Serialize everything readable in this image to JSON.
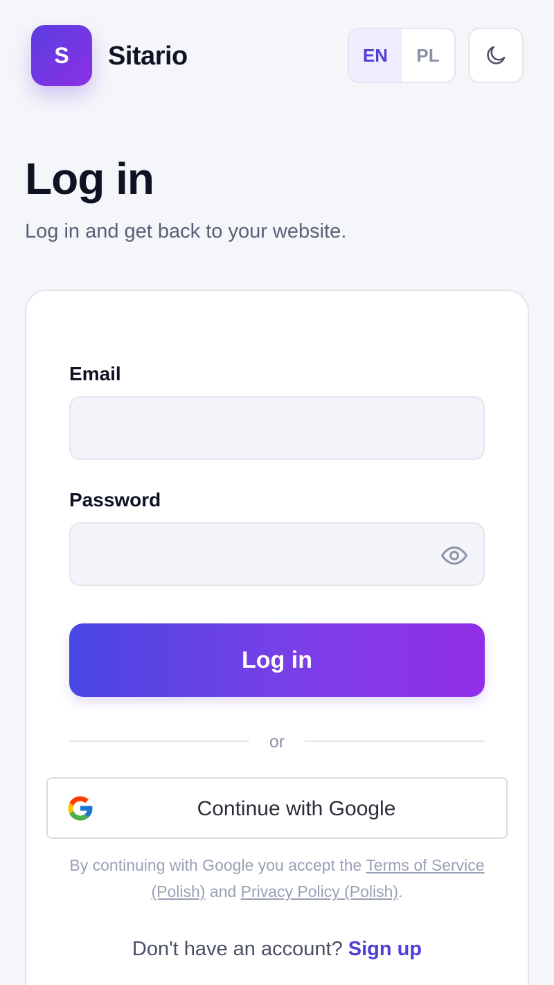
{
  "brand": {
    "logo_letter": "S",
    "name": "Sitario"
  },
  "header": {
    "languages": [
      {
        "code": "EN",
        "active": true
      },
      {
        "code": "PL",
        "active": false
      }
    ],
    "theme_toggle_icon": "moon-icon"
  },
  "heading": {
    "title": "Log in",
    "subtitle": "Log in and get back to your website."
  },
  "form": {
    "email_label": "Email",
    "email_value": "",
    "password_label": "Password",
    "password_value": "",
    "password_toggle_icon": "eye-icon",
    "submit_label": "Log in",
    "divider_text": "or",
    "google_label": "Continue with Google",
    "legal": {
      "prefix": "By continuing with Google you accept the ",
      "terms_link": "Terms of Service (Polish)",
      "middle": " and ",
      "privacy_link": "Privacy Policy (Polish)",
      "suffix": "."
    },
    "signup_prompt": "Don't have an account? ",
    "signup_link": "Sign up"
  },
  "colors": {
    "accent": "#4f3fd6",
    "gradient_start": "#4a46e2",
    "gradient_end": "#922ee8",
    "background": "#f5f6fa"
  }
}
